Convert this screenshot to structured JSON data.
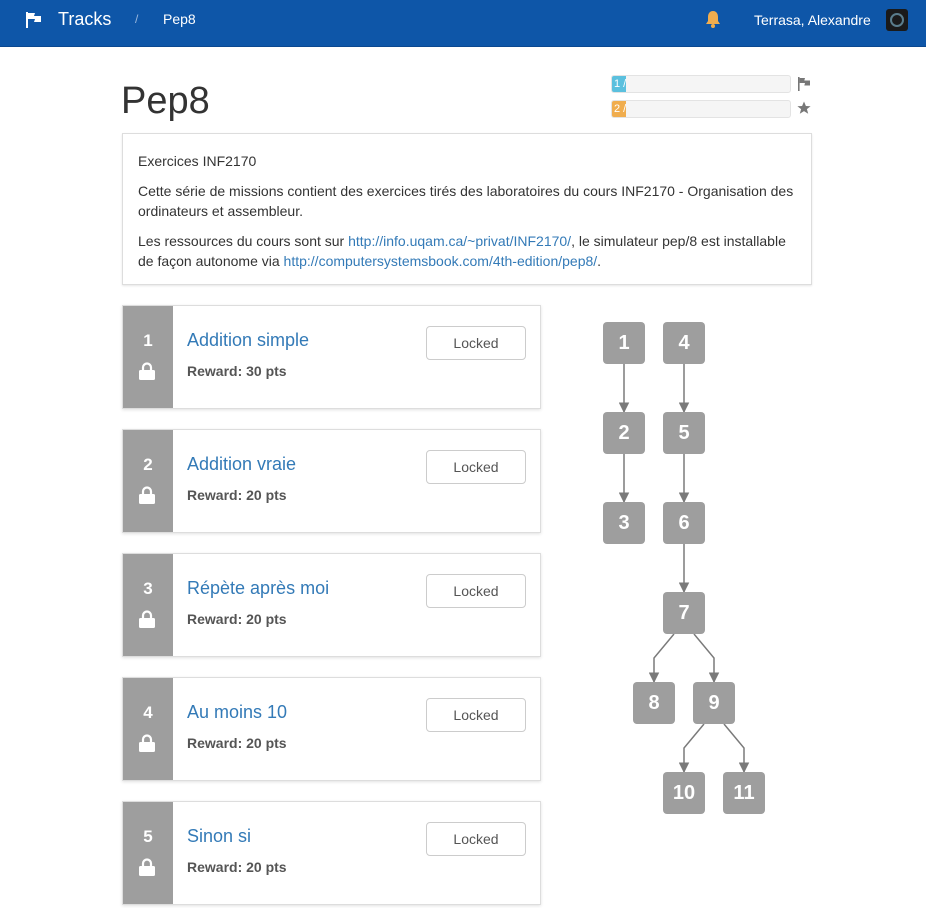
{
  "navbar": {
    "brand": "Tracks",
    "separator": "/",
    "breadcrumb": "Pep8",
    "user": "Terrasa, Alexandre"
  },
  "page": {
    "title": "Pep8"
  },
  "progress": [
    {
      "label": "1 /",
      "fraction": 0.08,
      "color": "#5bc0de",
      "icon": "flag-icon"
    },
    {
      "label": "2 /",
      "fraction": 0.08,
      "color": "#f0ad4e",
      "icon": "star-icon"
    }
  ],
  "description": {
    "heading": "Exercices INF2170",
    "para1": "Cette série de missions contient des exercices tirés des laboratoires du cours INF2170 - Organisation des ordinateurs et assembleur.",
    "para2_before": "Les ressources du cours sont sur ",
    "link1": "http://info.uqam.ca/~privat/INF2170/",
    "para2_middle": ", le simulateur pep/8 est installable de façon autonome via ",
    "link2": "http://computersystemsbook.com/4th-edition/pep8/",
    "para2_after": "."
  },
  "missions": [
    {
      "number": "1",
      "title": "Addition simple",
      "reward": "Reward: 30 pts",
      "status": "Locked"
    },
    {
      "number": "2",
      "title": "Addition vraie",
      "reward": "Reward: 20 pts",
      "status": "Locked"
    },
    {
      "number": "3",
      "title": "Répète après moi",
      "reward": "Reward: 20 pts",
      "status": "Locked"
    },
    {
      "number": "4",
      "title": "Au moins 10",
      "reward": "Reward: 20 pts",
      "status": "Locked"
    },
    {
      "number": "5",
      "title": "Sinon si",
      "reward": "Reward: 20 pts",
      "status": "Locked"
    }
  ],
  "graph": {
    "nodes": [
      "1",
      "2",
      "3",
      "4",
      "5",
      "6",
      "7",
      "8",
      "9",
      "10",
      "11"
    ],
    "edges": [
      [
        "1",
        "2"
      ],
      [
        "2",
        "3"
      ],
      [
        "4",
        "5"
      ],
      [
        "5",
        "6"
      ],
      [
        "6",
        "7"
      ],
      [
        "7",
        "8"
      ],
      [
        "7",
        "9"
      ],
      [
        "9",
        "10"
      ],
      [
        "9",
        "11"
      ]
    ]
  },
  "colors": {
    "navbar": "#0e56a8",
    "link": "#337ab7",
    "locked_node": "#9e9e9e",
    "bell": "#f0ad4e"
  }
}
